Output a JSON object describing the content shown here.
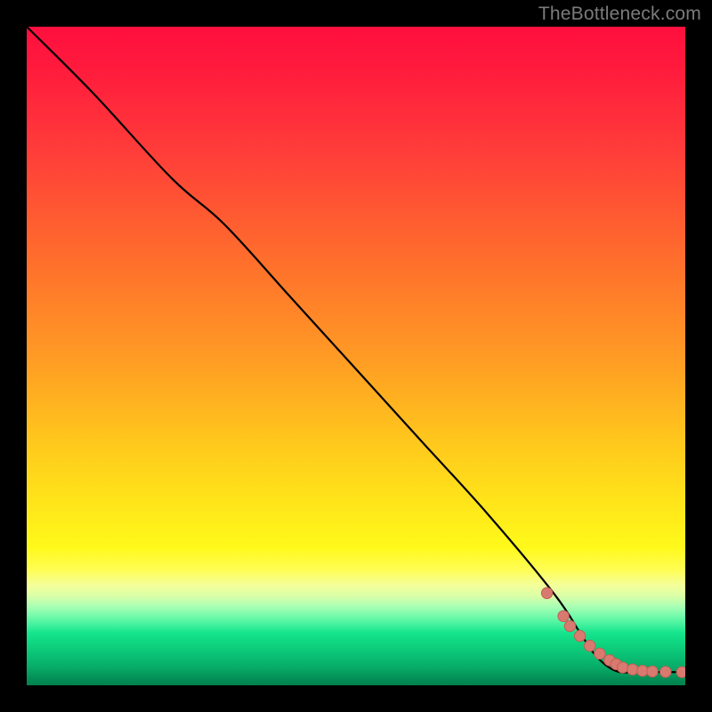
{
  "attribution": "TheBottleneck.com",
  "chart_data": {
    "type": "line",
    "title": "",
    "xlabel": "",
    "ylabel": "",
    "xlim": [
      0,
      100
    ],
    "ylim": [
      0,
      100
    ],
    "series": [
      {
        "name": "curve",
        "x": [
          0,
          10,
          22,
          30,
          40,
          50,
          60,
          70,
          80,
          84,
          86,
          88,
          90,
          92,
          95,
          100
        ],
        "y": [
          100,
          90,
          77,
          70,
          59,
          48,
          37,
          26,
          14,
          8,
          5,
          3,
          2,
          2,
          2,
          2
        ]
      }
    ],
    "markers": {
      "name": "points",
      "x": [
        79,
        81.5,
        82.5,
        84,
        85.5,
        87,
        88.5,
        89.5,
        90.5,
        92,
        93.5,
        95,
        97,
        99.5
      ],
      "y": [
        14,
        10.5,
        9,
        7.5,
        6,
        4.8,
        3.8,
        3.2,
        2.7,
        2.4,
        2.2,
        2.1,
        2.05,
        2
      ]
    }
  },
  "colors": {
    "line": "#000000",
    "marker_fill": "#d87a70",
    "marker_stroke": "#c45f55"
  }
}
